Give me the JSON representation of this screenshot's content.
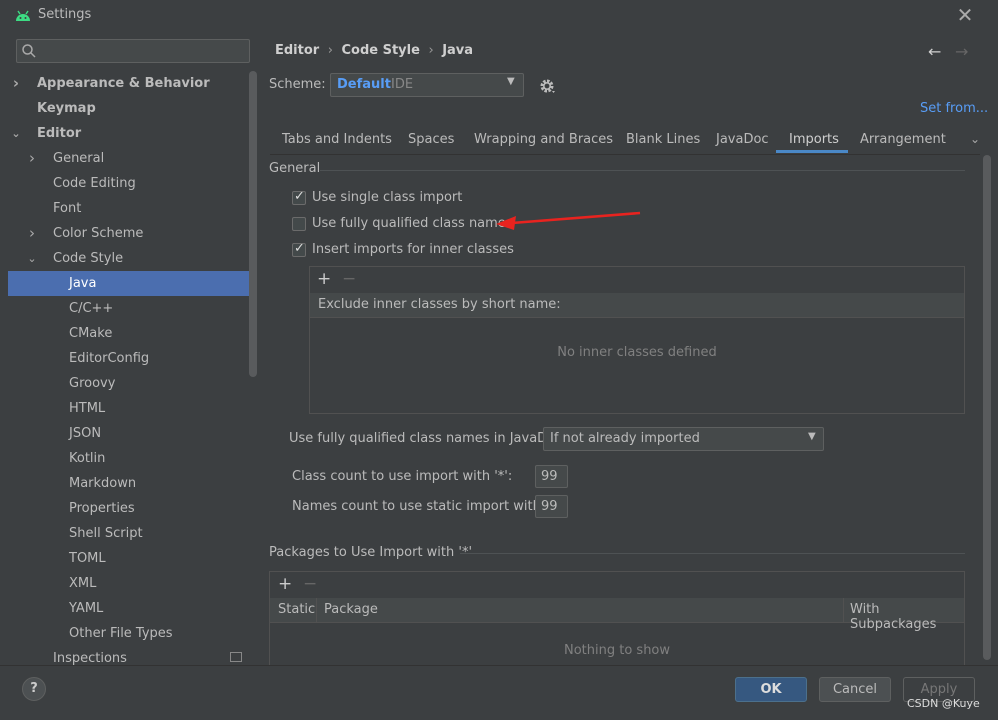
{
  "window": {
    "title": "Settings",
    "close": "✕"
  },
  "search": {
    "placeholder": "Q-"
  },
  "tree": [
    {
      "label": "Appearance & Behavior",
      "bold": true,
      "indent": 0,
      "arrow": "right"
    },
    {
      "label": "Keymap",
      "bold": true,
      "indent": 0,
      "arrow": ""
    },
    {
      "label": "Editor",
      "bold": true,
      "indent": 0,
      "arrow": "down"
    },
    {
      "label": "General",
      "bold": false,
      "indent": 1,
      "arrow": "right"
    },
    {
      "label": "Code Editing",
      "bold": false,
      "indent": 1,
      "arrow": ""
    },
    {
      "label": "Font",
      "bold": false,
      "indent": 1,
      "arrow": ""
    },
    {
      "label": "Color Scheme",
      "bold": false,
      "indent": 1,
      "arrow": "right"
    },
    {
      "label": "Code Style",
      "bold": false,
      "indent": 1,
      "arrow": "down"
    },
    {
      "label": "Java",
      "bold": false,
      "indent": 2,
      "arrow": "",
      "selected": true
    },
    {
      "label": "C/C++",
      "bold": false,
      "indent": 2,
      "arrow": ""
    },
    {
      "label": "CMake",
      "bold": false,
      "indent": 2,
      "arrow": ""
    },
    {
      "label": "EditorConfig",
      "bold": false,
      "indent": 2,
      "arrow": ""
    },
    {
      "label": "Groovy",
      "bold": false,
      "indent": 2,
      "arrow": ""
    },
    {
      "label": "HTML",
      "bold": false,
      "indent": 2,
      "arrow": ""
    },
    {
      "label": "JSON",
      "bold": false,
      "indent": 2,
      "arrow": ""
    },
    {
      "label": "Kotlin",
      "bold": false,
      "indent": 2,
      "arrow": ""
    },
    {
      "label": "Markdown",
      "bold": false,
      "indent": 2,
      "arrow": ""
    },
    {
      "label": "Properties",
      "bold": false,
      "indent": 2,
      "arrow": ""
    },
    {
      "label": "Shell Script",
      "bold": false,
      "indent": 2,
      "arrow": ""
    },
    {
      "label": "TOML",
      "bold": false,
      "indent": 2,
      "arrow": ""
    },
    {
      "label": "XML",
      "bold": false,
      "indent": 2,
      "arrow": ""
    },
    {
      "label": "YAML",
      "bold": false,
      "indent": 2,
      "arrow": ""
    },
    {
      "label": "Other File Types",
      "bold": false,
      "indent": 2,
      "arrow": ""
    },
    {
      "label": "Inspections",
      "bold": false,
      "indent": 1,
      "arrow": ""
    }
  ],
  "breadcrumb": [
    "Editor",
    "›",
    "Code Style",
    "›",
    "Java"
  ],
  "nav": {
    "back": "←",
    "forward": "→"
  },
  "scheme": {
    "label": "Scheme:",
    "value": "Default",
    "type": "IDE",
    "set_from": "Set from..."
  },
  "tabs": [
    "Tabs and Indents",
    "Spaces",
    "Wrapping and Braces",
    "Blank Lines",
    "JavaDoc",
    "Imports",
    "Arrangement"
  ],
  "active_tab": "Imports",
  "general": {
    "title": "General",
    "options": [
      {
        "label": "Use single class import",
        "checked": true
      },
      {
        "label": "Use fully qualified class names",
        "checked": false
      },
      {
        "label": "Insert imports for inner classes",
        "checked": true
      }
    ],
    "inner_table": {
      "add": "+",
      "remove": "−",
      "header": "Exclude inner classes by short name:",
      "empty": "No inner classes defined"
    },
    "fq_javadoc": {
      "label": "Use fully qualified class names in JavaDoc:",
      "value": "If not already imported"
    },
    "class_count": {
      "label": "Class count to use import with '*':",
      "value": "99"
    },
    "names_count": {
      "label": "Names count to use static import with '*':",
      "value": "99"
    }
  },
  "packages": {
    "title": "Packages to Use Import with '*'",
    "add": "+",
    "remove": "−",
    "columns": [
      "Static",
      "Package",
      "With Subpackages"
    ],
    "empty": "Nothing to show"
  },
  "footer": {
    "help": "?",
    "ok": "OK",
    "cancel": "Cancel",
    "apply": "Apply"
  },
  "watermark": "CSDN @Kuye",
  "colors": {
    "accent": "#4b6eaf",
    "link": "#589df6",
    "annotation": "#e8231f"
  }
}
